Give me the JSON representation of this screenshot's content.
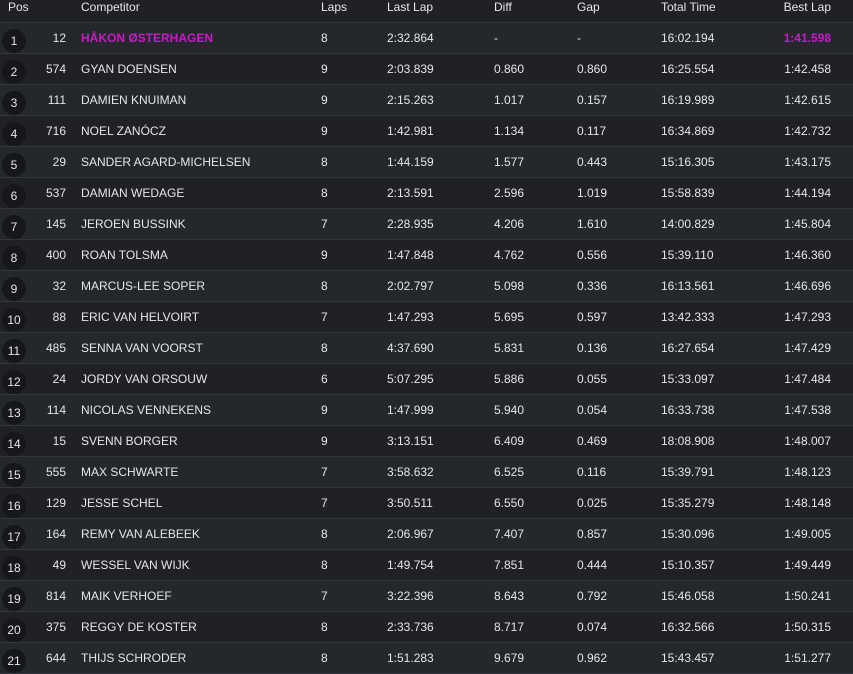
{
  "headers": {
    "pos": "Pos",
    "competitor": "Competitor",
    "laps": "Laps",
    "last_lap": "Last Lap",
    "diff": "Diff",
    "gap": "Gap",
    "total_time": "Total Time",
    "best_lap": "Best Lap"
  },
  "colors": {
    "highlight": "#c81bc8",
    "background": "#1f2126"
  },
  "rows": [
    {
      "pos": "1",
      "num": "12",
      "name": "HÅKON ØSTERHAGEN",
      "laps": "8",
      "last": "2:32.864",
      "diff": "-",
      "gap": "-",
      "total": "16:02.194",
      "best": "1:41.598"
    },
    {
      "pos": "2",
      "num": "574",
      "name": "GYAN DOENSEN",
      "laps": "9",
      "last": "2:03.839",
      "diff": "0.860",
      "gap": "0.860",
      "total": "16:25.554",
      "best": "1:42.458"
    },
    {
      "pos": "3",
      "num": "111",
      "name": "DAMIEN KNUIMAN",
      "laps": "9",
      "last": "2:15.263",
      "diff": "1.017",
      "gap": "0.157",
      "total": "16:19.989",
      "best": "1:42.615"
    },
    {
      "pos": "4",
      "num": "716",
      "name": "NOEL ZANÓCZ",
      "laps": "9",
      "last": "1:42.981",
      "diff": "1.134",
      "gap": "0.117",
      "total": "16:34.869",
      "best": "1:42.732"
    },
    {
      "pos": "5",
      "num": "29",
      "name": "SANDER AGARD-MICHELSEN",
      "laps": "8",
      "last": "1:44.159",
      "diff": "1.577",
      "gap": "0.443",
      "total": "15:16.305",
      "best": "1:43.175"
    },
    {
      "pos": "6",
      "num": "537",
      "name": "DAMIAN WEDAGE",
      "laps": "8",
      "last": "2:13.591",
      "diff": "2.596",
      "gap": "1.019",
      "total": "15:58.839",
      "best": "1:44.194"
    },
    {
      "pos": "7",
      "num": "145",
      "name": "JEROEN BUSSINK",
      "laps": "7",
      "last": "2:28.935",
      "diff": "4.206",
      "gap": "1.610",
      "total": "14:00.829",
      "best": "1:45.804"
    },
    {
      "pos": "8",
      "num": "400",
      "name": "ROAN TOLSMA",
      "laps": "9",
      "last": "1:47.848",
      "diff": "4.762",
      "gap": "0.556",
      "total": "15:39.110",
      "best": "1:46.360"
    },
    {
      "pos": "9",
      "num": "32",
      "name": "MARCUS-LEE SOPER",
      "laps": "8",
      "last": "2:02.797",
      "diff": "5.098",
      "gap": "0.336",
      "total": "16:13.561",
      "best": "1:46.696"
    },
    {
      "pos": "10",
      "num": "88",
      "name": "ERIC VAN HELVOIRT",
      "laps": "7",
      "last": "1:47.293",
      "diff": "5.695",
      "gap": "0.597",
      "total": "13:42.333",
      "best": "1:47.293"
    },
    {
      "pos": "11",
      "num": "485",
      "name": "SENNA VAN VOORST",
      "laps": "8",
      "last": "4:37.690",
      "diff": "5.831",
      "gap": "0.136",
      "total": "16:27.654",
      "best": "1:47.429"
    },
    {
      "pos": "12",
      "num": "24",
      "name": "JORDY VAN ORSOUW",
      "laps": "6",
      "last": "5:07.295",
      "diff": "5.886",
      "gap": "0.055",
      "total": "15:33.097",
      "best": "1:47.484"
    },
    {
      "pos": "13",
      "num": "114",
      "name": "NICOLAS VENNEKENS",
      "laps": "9",
      "last": "1:47.999",
      "diff": "5.940",
      "gap": "0.054",
      "total": "16:33.738",
      "best": "1:47.538"
    },
    {
      "pos": "14",
      "num": "15",
      "name": "SVENN BORGER",
      "laps": "9",
      "last": "3:13.151",
      "diff": "6.409",
      "gap": "0.469",
      "total": "18:08.908",
      "best": "1:48.007"
    },
    {
      "pos": "15",
      "num": "555",
      "name": "MAX SCHWARTE",
      "laps": "7",
      "last": "3:58.632",
      "diff": "6.525",
      "gap": "0.116",
      "total": "15:39.791",
      "best": "1:48.123"
    },
    {
      "pos": "16",
      "num": "129",
      "name": "JESSE SCHEL",
      "laps": "7",
      "last": "3:50.511",
      "diff": "6.550",
      "gap": "0.025",
      "total": "15:35.279",
      "best": "1:48.148"
    },
    {
      "pos": "17",
      "num": "164",
      "name": "REMY VAN ALEBEEK",
      "laps": "8",
      "last": "2:06.967",
      "diff": "7.407",
      "gap": "0.857",
      "total": "15:30.096",
      "best": "1:49.005"
    },
    {
      "pos": "18",
      "num": "49",
      "name": "WESSEL VAN WIJK",
      "laps": "8",
      "last": "1:49.754",
      "diff": "7.851",
      "gap": "0.444",
      "total": "15:10.357",
      "best": "1:49.449"
    },
    {
      "pos": "19",
      "num": "814",
      "name": "MAIK VERHOEF",
      "laps": "7",
      "last": "3:22.396",
      "diff": "8.643",
      "gap": "0.792",
      "total": "15:46.058",
      "best": "1:50.241"
    },
    {
      "pos": "20",
      "num": "375",
      "name": "REGGY DE KOSTER",
      "laps": "8",
      "last": "2:33.736",
      "diff": "8.717",
      "gap": "0.074",
      "total": "16:32.566",
      "best": "1:50.315"
    },
    {
      "pos": "21",
      "num": "644",
      "name": "THIJS SCHRODER",
      "laps": "8",
      "last": "1:51.283",
      "diff": "9.679",
      "gap": "0.962",
      "total": "15:43.457",
      "best": "1:51.277"
    }
  ]
}
